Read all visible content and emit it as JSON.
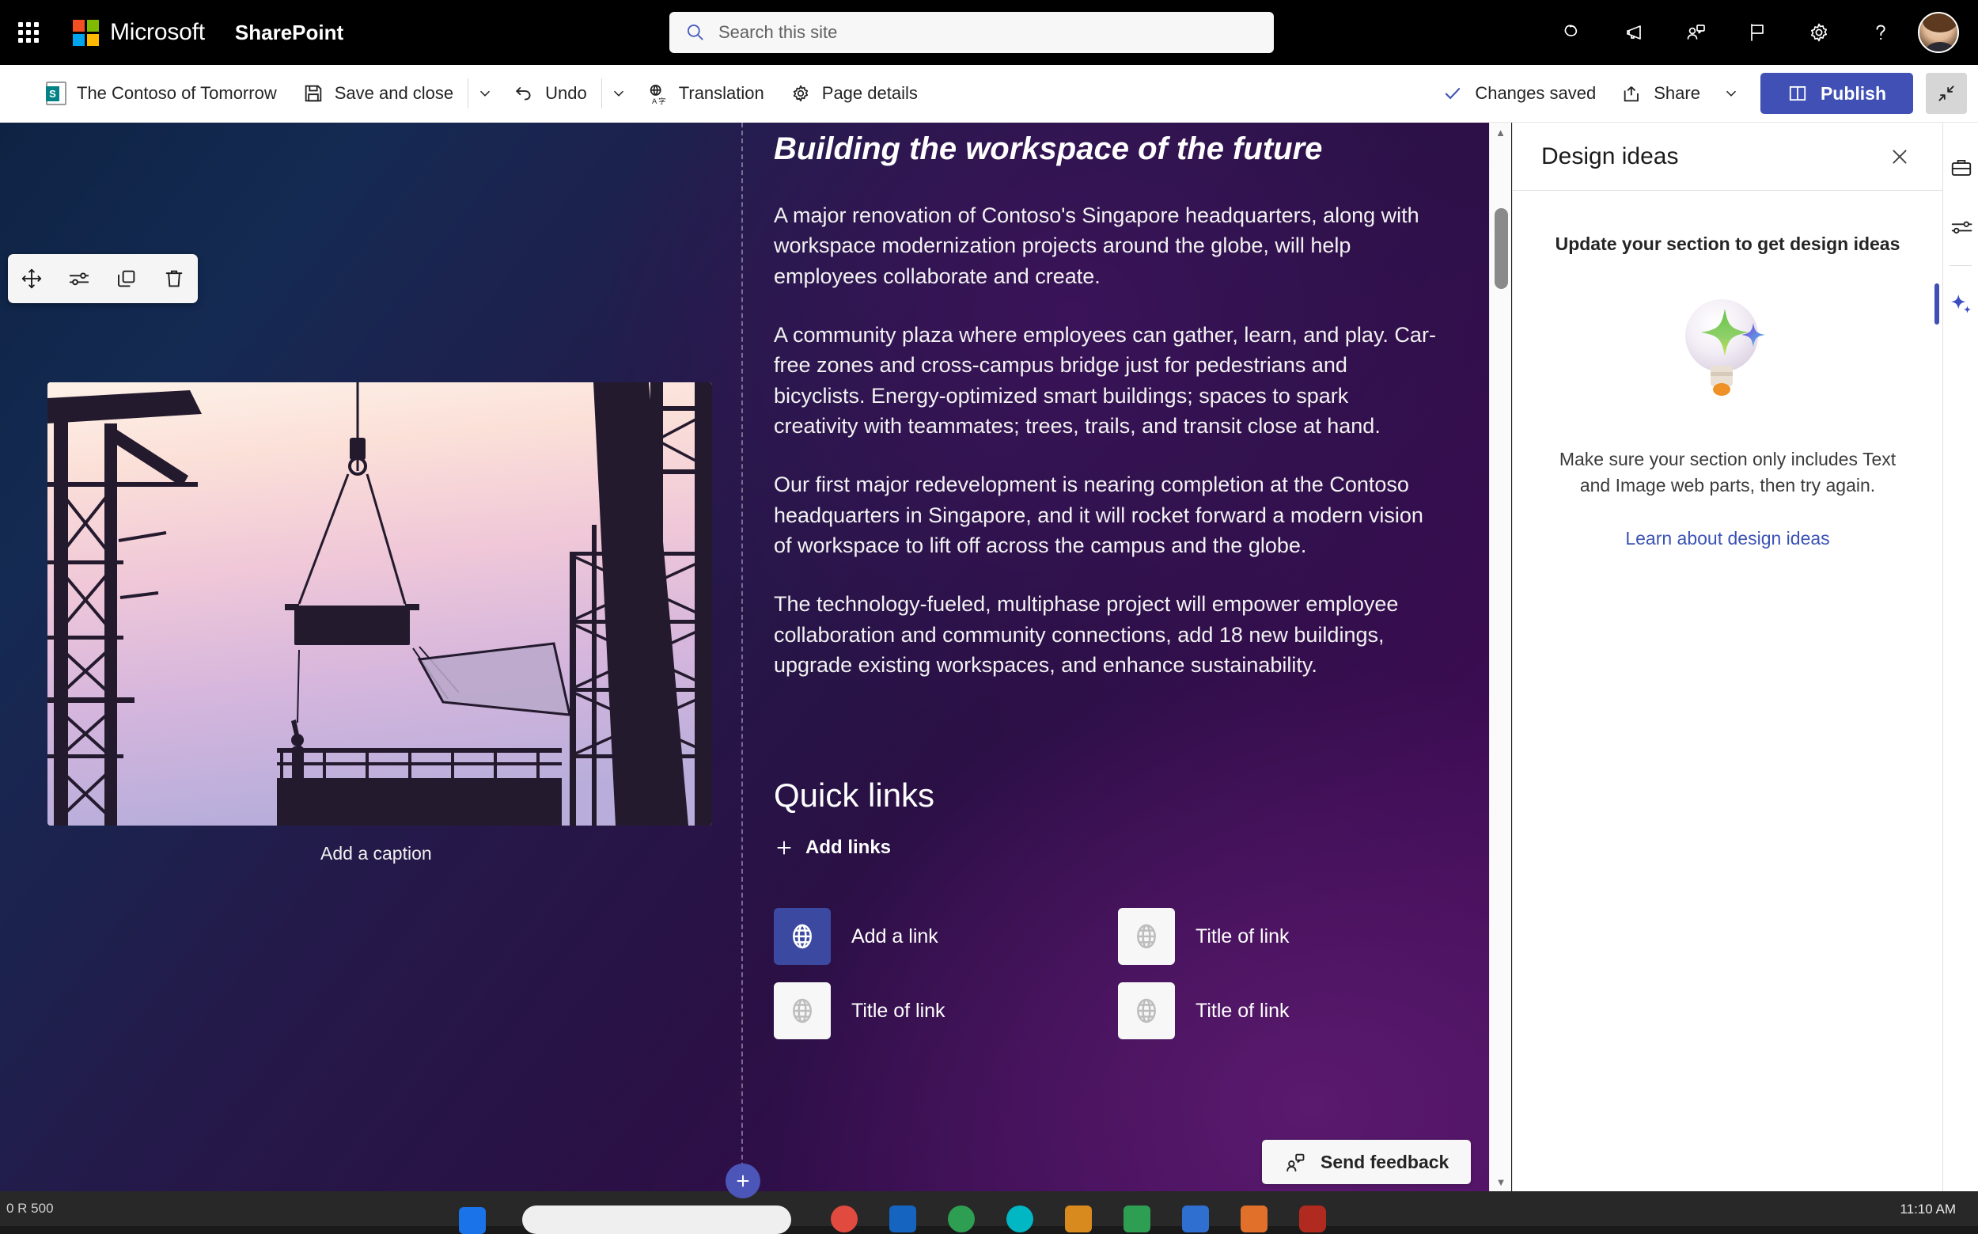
{
  "suite": {
    "waffle_label": "App launcher",
    "brand": "Microsoft",
    "app_name": "SharePoint",
    "search_placeholder": "Search this site",
    "search_value": "",
    "icons": [
      {
        "name": "copilot-icon",
        "label": "Copilot"
      },
      {
        "name": "megaphone-icon",
        "label": "Announcements"
      },
      {
        "name": "feedback-person-icon",
        "label": "Feedback"
      },
      {
        "name": "flag-icon",
        "label": "Diagnostics"
      },
      {
        "name": "gear-icon",
        "label": "Settings"
      },
      {
        "name": "help-icon",
        "label": "Help"
      }
    ],
    "avatar_label": "Account manager"
  },
  "command_bar": {
    "page_title": "The Contoso of Tomorrow",
    "save_and_close": "Save and close",
    "undo": "Undo",
    "translation": "Translation",
    "page_details": "Page details",
    "changes_saved": "Changes saved",
    "share": "Share",
    "publish": "Publish",
    "collapse_label": "Exit full screen"
  },
  "webpart_toolbar": {
    "move": "Move web part",
    "edit": "Edit web part",
    "duplicate": "Duplicate web part",
    "delete": "Delete web part"
  },
  "canvas": {
    "image": {
      "caption_placeholder": "Add a caption",
      "alt": "Construction site silhouette at dusk with crane lifting materials"
    },
    "article": {
      "heading": "Building the workspace of the future",
      "paragraphs": [
        "A major renovation of Contoso's Singapore headquarters, along with workspace modernization projects around the globe, will help employees collaborate and create.",
        "A community plaza where employees can gather, learn, and play. Car-free zones and cross-campus bridge just for pedestrians and bicyclists. Energy-optimized smart buildings; spaces to spark creativity with teammates; trees, trails, and transit close at hand.",
        "Our first major redevelopment is nearing completion at the Contoso headquarters in Singapore, and it will rocket forward a modern vision of workspace to lift off across the campus and the globe.",
        "The technology-fueled, multiphase project will empower employee collaboration and community connections, add 18 new buildings, upgrade existing workspaces, and enhance sustainability."
      ]
    },
    "quick_links": {
      "title": "Quick links",
      "add_links": "Add links",
      "items": [
        {
          "label": "Add a link",
          "state": "active"
        },
        {
          "label": "Title of link",
          "state": "default"
        },
        {
          "label": "Title of link",
          "state": "default"
        },
        {
          "label": "Title of link",
          "state": "default"
        }
      ]
    },
    "send_feedback": "Send feedback",
    "add_section": "+"
  },
  "panel": {
    "title": "Design ideas",
    "close_label": "Close",
    "lead": "Update your section to get design ideas",
    "description": "Make sure your section only includes Text and Image web parts, then try again.",
    "link": "Learn about design ideas"
  },
  "rail": {
    "items": [
      {
        "name": "toolbox-icon",
        "label": "Toolbox",
        "active": false
      },
      {
        "name": "sliders-icon",
        "label": "Properties",
        "active": false
      },
      {
        "name": "sparkle-icon",
        "label": "Design ideas",
        "active": true
      }
    ]
  },
  "colors": {
    "accent": "#4050b5",
    "panel_link": "#3b52b4",
    "quicklink_active": "#3b4aa0"
  },
  "taskbar": {
    "left_text": "0 R 500",
    "clock": "11:10 AM"
  }
}
